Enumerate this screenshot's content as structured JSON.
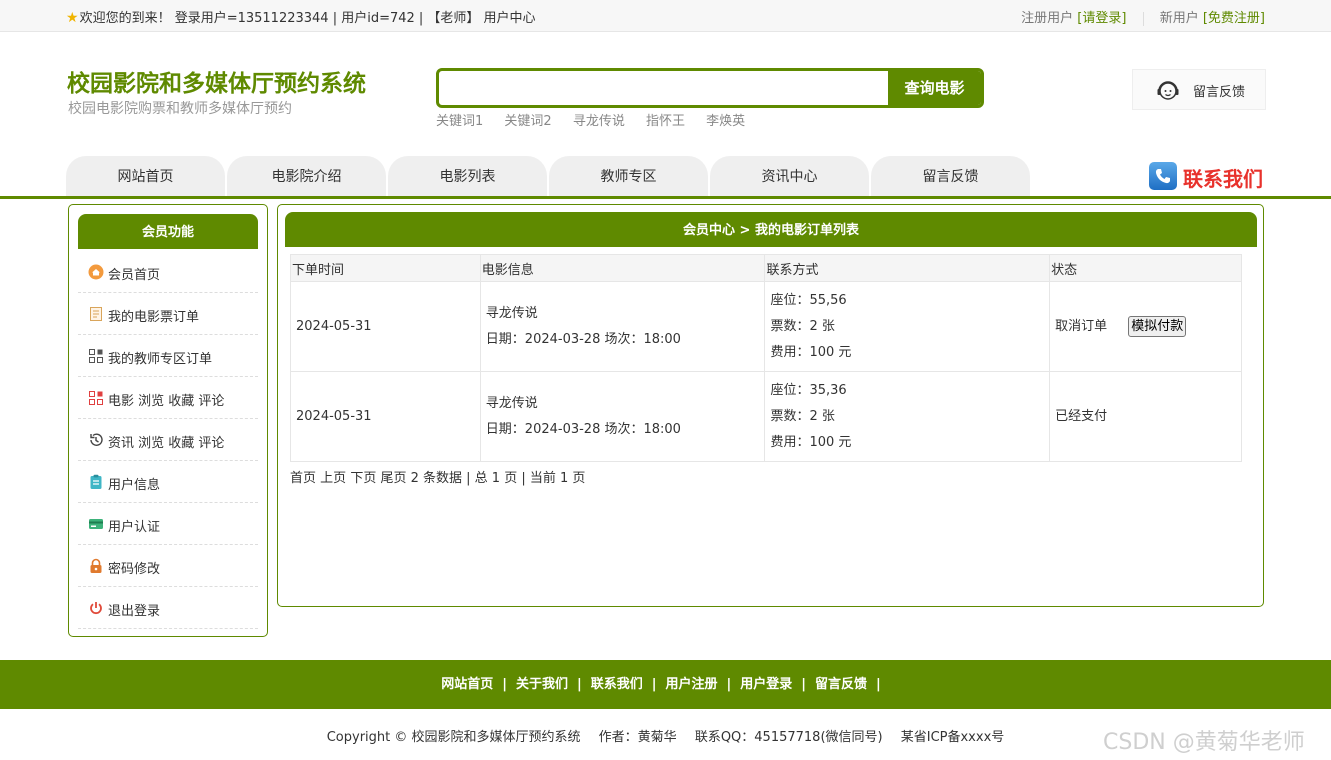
{
  "topbar": {
    "welcome": "欢迎您的到来！ 登录用户=13511223344 | 用户id=742 | 【老师】 用户中心",
    "registered_user": "注册用户",
    "login_link": "[请登录]",
    "new_user": "新用户",
    "register_link": "[免费注册]"
  },
  "header": {
    "title": "校园影院和多媒体厅预约系统",
    "subtitle": "校园电影院购票和教师多媒体厅预约",
    "search_placeholder": "",
    "search_button": "查询电影",
    "keywords": [
      "关键词1",
      "关键词2",
      "寻龙传说",
      "指怀王",
      "李焕英"
    ],
    "feedback": "留言反馈"
  },
  "nav": {
    "items": [
      "网站首页",
      "电影院介绍",
      "电影列表",
      "教师专区",
      "资讯中心",
      "留言反馈"
    ],
    "contact": "联系我们"
  },
  "sidebar": {
    "title": "会员功能",
    "items": [
      {
        "label": "会员首页",
        "icon": "home-icon"
      },
      {
        "label": "我的电影票订单",
        "icon": "document-icon"
      },
      {
        "label": "我的教师专区订单",
        "icon": "grid-icon"
      },
      {
        "label": "电影 浏览 收藏 评论",
        "icon": "grid-red-icon"
      },
      {
        "label": "资讯 浏览 收藏 评论",
        "icon": "history-icon"
      },
      {
        "label": "用户信息",
        "icon": "clipboard-icon"
      },
      {
        "label": "用户认证",
        "icon": "card-icon"
      },
      {
        "label": "密码修改",
        "icon": "lock-icon"
      },
      {
        "label": "退出登录",
        "icon": "power-icon"
      }
    ]
  },
  "main": {
    "title": "会员中心 > 我的电影订单列表",
    "columns": [
      "下单时间",
      "电影信息",
      "联系方式",
      "状态"
    ],
    "rows": [
      {
        "time": "2024-05-31",
        "movie": "寻龙传说",
        "schedule": "日期：2024-03-28 场次：18:00",
        "seat": "座位：55,56",
        "tickets": "票数：2 张",
        "fee": "费用：100 元",
        "status": "取消订单",
        "action": "模拟付款"
      },
      {
        "time": "2024-05-31",
        "movie": "寻龙传说",
        "schedule": "日期：2024-03-28 场次：18:00",
        "seat": "座位：35,36",
        "tickets": "票数：2 张",
        "fee": "费用：100 元",
        "status": "已经支付",
        "action": ""
      }
    ],
    "pager": {
      "first": "首页",
      "prev": "上页",
      "next": "下页",
      "last": "尾页",
      "summary": "2 条数据 | 总 1 页 | 当前 1 页"
    }
  },
  "footer": {
    "links": [
      "网站首页",
      "关于我们",
      "联系我们",
      "用户注册",
      "用户登录",
      "留言反馈"
    ],
    "copyright": "Copyright © 校园影院和多媒体厅预约系统",
    "author": "作者：黄菊华",
    "qq": "联系QQ：45157718(微信同号)",
    "icp": "某省ICP备xxxx号",
    "watermark": "CSDN @黄菊华老师"
  },
  "colors": {
    "brand_green": "#5f8a00",
    "contact_red": "#e8322c"
  }
}
